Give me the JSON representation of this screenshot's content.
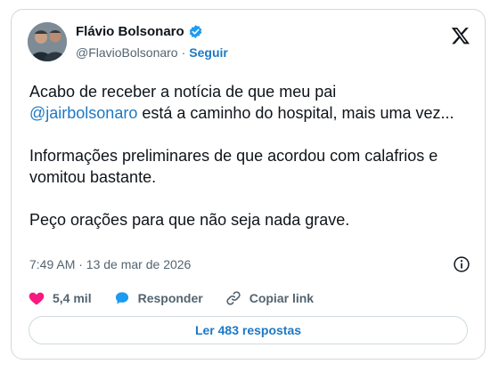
{
  "author": {
    "name": "Flávio Bolsonaro",
    "handle": "@FlavioBolsonaro",
    "separator": "·",
    "follow_label": "Seguir"
  },
  "tweet": {
    "line1": "Acabo de receber a notícia de que meu pai",
    "mention": "@jairbolsonaro",
    "line1_cont": " está a caminho do hospital, mais uma vez...",
    "para2": "Informações preliminares de que acordou com calafrios e vomitou bastante.",
    "para3": "Peço orações para que não seja nada grave."
  },
  "meta": {
    "timestamp": "7:49 AM · 13 de mar de 2026"
  },
  "actions": {
    "likes": "5,4 mil",
    "reply_label": "Responder",
    "copy_label": "Copiar link"
  },
  "read_replies_label": "Ler 483 respostas",
  "colors": {
    "accent": "#1d78c4",
    "like": "#f91880",
    "text": "#0f1419",
    "muted": "#536471"
  },
  "icons": [
    "verified-badge-icon",
    "x-logo-icon",
    "info-icon",
    "heart-icon",
    "reply-bubble-icon",
    "link-icon"
  ]
}
